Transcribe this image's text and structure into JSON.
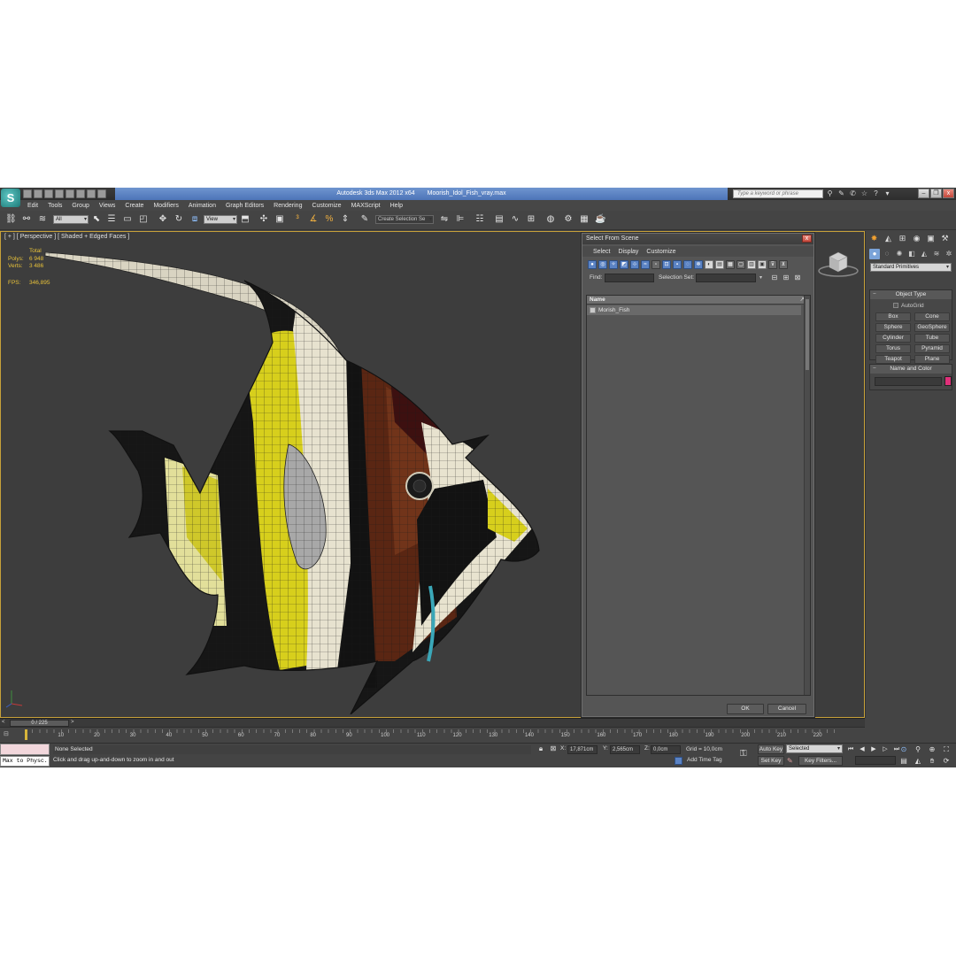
{
  "window": {
    "app_title": "Autodesk 3ds Max  2012 x64",
    "file_name": "Moorish_Idol_Fish_vray.max",
    "help_search_placeholder": "Type a keyword or phrase"
  },
  "menu": [
    "Edit",
    "Tools",
    "Group",
    "Views",
    "Create",
    "Modifiers",
    "Animation",
    "Graph Editors",
    "Rendering",
    "Customize",
    "MAXScript",
    "Help"
  ],
  "toolbar": {
    "selection_filter": "All",
    "reference_coord": "View",
    "named_selection_set": "Create Selection Se"
  },
  "viewport": {
    "label": "[ + ] [ Perspective ] [ Shaded + Edged Faces ]",
    "stats": {
      "header": "Total",
      "polys_label": "Polys:",
      "polys_value": "6 948",
      "verts_label": "Verts:",
      "verts_value": "3 486",
      "fps_label": "FPS:",
      "fps_value": "346,895"
    },
    "colors": {
      "border": "#c7a13a",
      "stats_text": "#e8c23a",
      "background": "#3d3d3d"
    }
  },
  "dialog": {
    "title": "Select From Scene",
    "close": "x",
    "menu": [
      "Select",
      "Display",
      "Customize"
    ],
    "find_label": "Find:",
    "selection_set_label": "Selection Set:",
    "column_header": "Name",
    "column_header_end": "↗",
    "rows": [
      "Morish_Fish"
    ],
    "ok_label": "OK",
    "cancel_label": "Cancel"
  },
  "command_panel": {
    "category_dropdown": "Standard Primitives",
    "object_type_title": "Object Type",
    "autogrid_label": "AutoGrid",
    "object_buttons": [
      "Box",
      "Cone",
      "Sphere",
      "GeoSphere",
      "Cylinder",
      "Tube",
      "Torus",
      "Pyramid",
      "Teapot",
      "Plane"
    ],
    "name_color_title": "Name and Color",
    "object_color": "#e0307a"
  },
  "timeline": {
    "slider_left": "<",
    "frame_display": "0 / 225",
    "slider_right": ">",
    "ticks": [
      "10",
      "20",
      "30",
      "40",
      "50",
      "60",
      "70",
      "80",
      "90",
      "100",
      "110",
      "120",
      "130",
      "140",
      "150",
      "160",
      "170",
      "180",
      "190",
      "200",
      "210",
      "220"
    ]
  },
  "status": {
    "maxscript_label": "Max to Physc.",
    "selection_status": "None Selected",
    "prompt": "Click and drag up-and-down to zoom in and out",
    "x_label": "X:",
    "x_value": "17,871cm",
    "y_label": "Y:",
    "y_value": "2,565cm",
    "z_label": "Z:",
    "z_value": "0,0cm",
    "grid": "Grid = 10,0cm",
    "add_time_tag": "Add Time Tag",
    "auto_key": "Auto Key",
    "set_key": "Set Key",
    "key_mode": "Selected",
    "key_filters": "Key Filters..."
  }
}
